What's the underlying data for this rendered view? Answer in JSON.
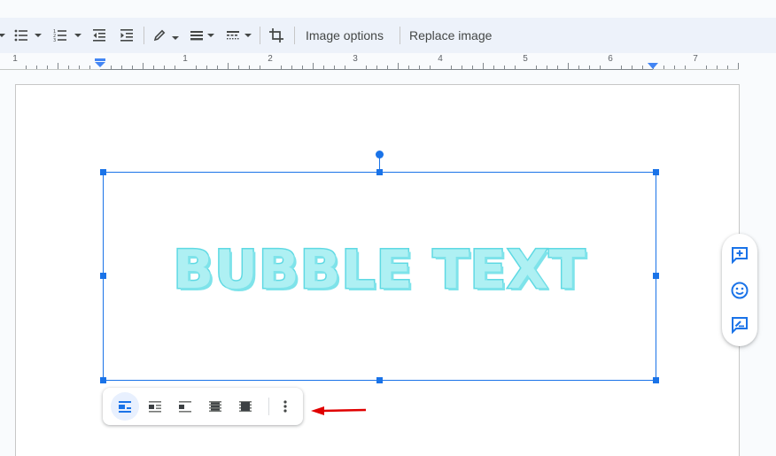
{
  "toolbar": {
    "items": [
      {
        "name": "bulleted-list",
        "icon": "bulleted-list-icon"
      },
      {
        "name": "numbered-list",
        "icon": "numbered-list-icon"
      },
      {
        "name": "decrease-indent",
        "icon": "decrease-indent-icon"
      },
      {
        "name": "increase-indent",
        "icon": "increase-indent-icon"
      },
      {
        "name": "border-color",
        "icon": "pencil-icon"
      },
      {
        "name": "border-weight",
        "icon": "border-weight-icon"
      },
      {
        "name": "border-dash",
        "icon": "border-dash-icon"
      },
      {
        "name": "crop-image",
        "icon": "crop-icon"
      }
    ],
    "image_options_label": "Image options",
    "replace_image_label": "Replace image"
  },
  "ruler": {
    "labels": [
      "1",
      "1",
      "2",
      "3",
      "4",
      "5",
      "6",
      "7"
    ],
    "unit": "inch"
  },
  "document": {
    "image_text": "BUBBLE TEXT",
    "image_colors": {
      "fill": "#aef0f3",
      "outline": "#5ed9e3"
    },
    "selection_color": "#1a73e8"
  },
  "image_wrap_toolbar": {
    "options": [
      {
        "name": "inline",
        "label": "In line",
        "active": true
      },
      {
        "name": "wrap-text",
        "label": "Wrap text",
        "active": false
      },
      {
        "name": "break-text",
        "label": "Break text",
        "active": false
      },
      {
        "name": "behind-text",
        "label": "Behind text",
        "active": false
      },
      {
        "name": "in-front-of-text",
        "label": "In front of text",
        "active": false
      }
    ],
    "more_options": "more-options"
  },
  "side_actions": [
    {
      "name": "add-comment",
      "icon": "add-comment-icon"
    },
    {
      "name": "add-emoji-reaction",
      "icon": "emoji-icon"
    },
    {
      "name": "suggest-edits",
      "icon": "suggest-edit-icon"
    }
  ],
  "annotation": {
    "type": "arrow",
    "color": "#e00000",
    "points_to": "more-options"
  }
}
